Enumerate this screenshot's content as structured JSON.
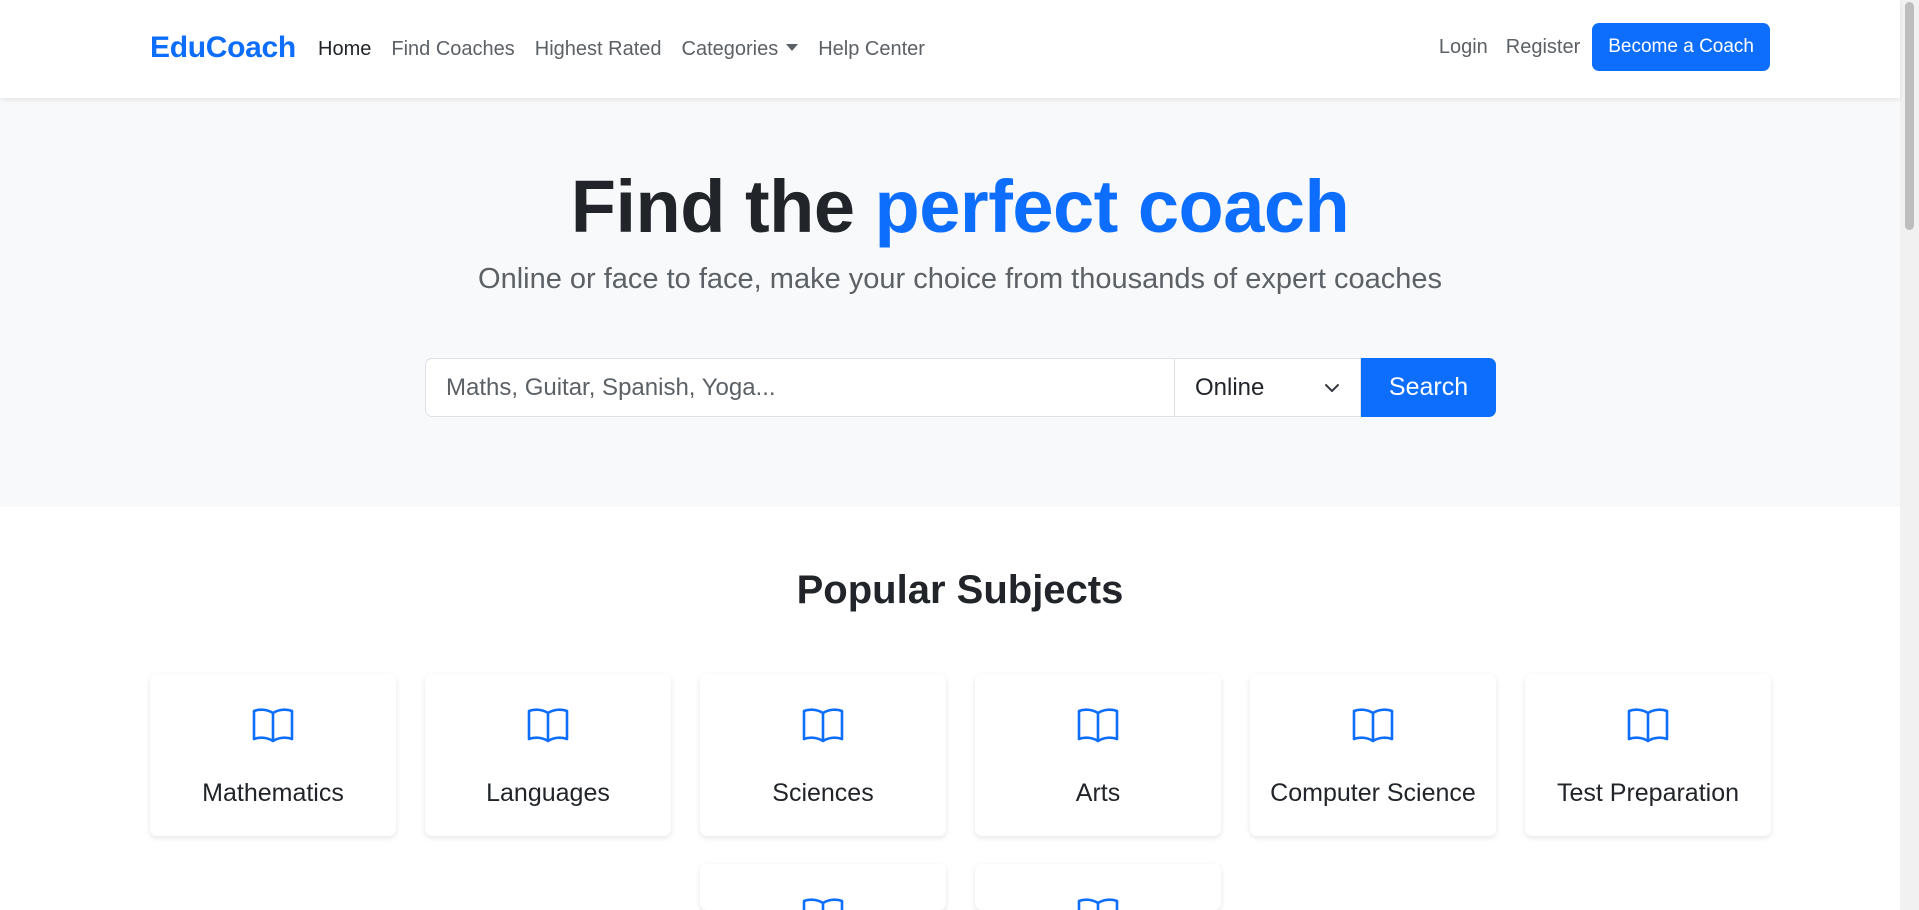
{
  "nav": {
    "brand": "EduCoach",
    "links": [
      "Home",
      "Find Coaches",
      "Highest Rated",
      "Categories",
      "Help Center"
    ],
    "login": "Login",
    "register": "Register",
    "cta": "Become a Coach"
  },
  "hero": {
    "title_part1": "Find the ",
    "title_accent": "perfect coach",
    "subtitle": "Online or face to face, make your choice from thousands of expert coaches",
    "search_placeholder": "Maths, Guitar, Spanish, Yoga...",
    "mode_value": "Online",
    "search_button": "Search"
  },
  "subjects": {
    "title": "Popular Subjects",
    "items": [
      "Mathematics",
      "Languages",
      "Sciences",
      "Arts",
      "Computer Science",
      "Test Preparation",
      "",
      ""
    ]
  },
  "icons": {
    "subject": "book-icon",
    "select": "chevron-down-icon"
  },
  "colors": {
    "accent": "#0d6efd",
    "text": "#212529",
    "muted": "#5c6166",
    "hero_bg": "#f8f9fa"
  }
}
